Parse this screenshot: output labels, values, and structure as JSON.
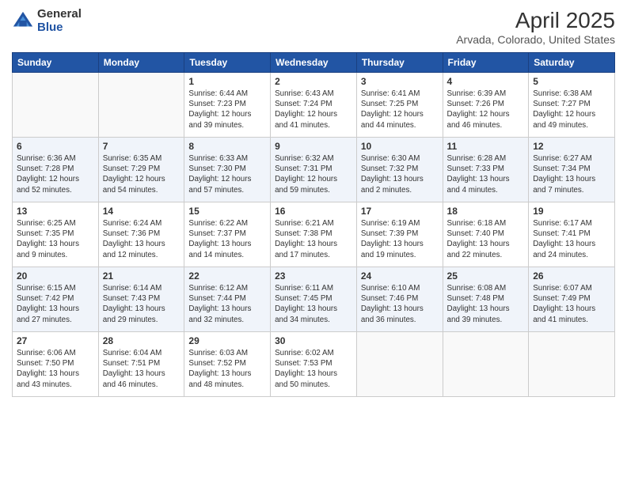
{
  "logo": {
    "general": "General",
    "blue": "Blue"
  },
  "title": "April 2025",
  "subtitle": "Arvada, Colorado, United States",
  "days_of_week": [
    "Sunday",
    "Monday",
    "Tuesday",
    "Wednesday",
    "Thursday",
    "Friday",
    "Saturday"
  ],
  "weeks": [
    [
      {
        "day": "",
        "info": ""
      },
      {
        "day": "",
        "info": ""
      },
      {
        "day": "1",
        "info": "Sunrise: 6:44 AM\nSunset: 7:23 PM\nDaylight: 12 hours and 39 minutes."
      },
      {
        "day": "2",
        "info": "Sunrise: 6:43 AM\nSunset: 7:24 PM\nDaylight: 12 hours and 41 minutes."
      },
      {
        "day": "3",
        "info": "Sunrise: 6:41 AM\nSunset: 7:25 PM\nDaylight: 12 hours and 44 minutes."
      },
      {
        "day": "4",
        "info": "Sunrise: 6:39 AM\nSunset: 7:26 PM\nDaylight: 12 hours and 46 minutes."
      },
      {
        "day": "5",
        "info": "Sunrise: 6:38 AM\nSunset: 7:27 PM\nDaylight: 12 hours and 49 minutes."
      }
    ],
    [
      {
        "day": "6",
        "info": "Sunrise: 6:36 AM\nSunset: 7:28 PM\nDaylight: 12 hours and 52 minutes."
      },
      {
        "day": "7",
        "info": "Sunrise: 6:35 AM\nSunset: 7:29 PM\nDaylight: 12 hours and 54 minutes."
      },
      {
        "day": "8",
        "info": "Sunrise: 6:33 AM\nSunset: 7:30 PM\nDaylight: 12 hours and 57 minutes."
      },
      {
        "day": "9",
        "info": "Sunrise: 6:32 AM\nSunset: 7:31 PM\nDaylight: 12 hours and 59 minutes."
      },
      {
        "day": "10",
        "info": "Sunrise: 6:30 AM\nSunset: 7:32 PM\nDaylight: 13 hours and 2 minutes."
      },
      {
        "day": "11",
        "info": "Sunrise: 6:28 AM\nSunset: 7:33 PM\nDaylight: 13 hours and 4 minutes."
      },
      {
        "day": "12",
        "info": "Sunrise: 6:27 AM\nSunset: 7:34 PM\nDaylight: 13 hours and 7 minutes."
      }
    ],
    [
      {
        "day": "13",
        "info": "Sunrise: 6:25 AM\nSunset: 7:35 PM\nDaylight: 13 hours and 9 minutes."
      },
      {
        "day": "14",
        "info": "Sunrise: 6:24 AM\nSunset: 7:36 PM\nDaylight: 13 hours and 12 minutes."
      },
      {
        "day": "15",
        "info": "Sunrise: 6:22 AM\nSunset: 7:37 PM\nDaylight: 13 hours and 14 minutes."
      },
      {
        "day": "16",
        "info": "Sunrise: 6:21 AM\nSunset: 7:38 PM\nDaylight: 13 hours and 17 minutes."
      },
      {
        "day": "17",
        "info": "Sunrise: 6:19 AM\nSunset: 7:39 PM\nDaylight: 13 hours and 19 minutes."
      },
      {
        "day": "18",
        "info": "Sunrise: 6:18 AM\nSunset: 7:40 PM\nDaylight: 13 hours and 22 minutes."
      },
      {
        "day": "19",
        "info": "Sunrise: 6:17 AM\nSunset: 7:41 PM\nDaylight: 13 hours and 24 minutes."
      }
    ],
    [
      {
        "day": "20",
        "info": "Sunrise: 6:15 AM\nSunset: 7:42 PM\nDaylight: 13 hours and 27 minutes."
      },
      {
        "day": "21",
        "info": "Sunrise: 6:14 AM\nSunset: 7:43 PM\nDaylight: 13 hours and 29 minutes."
      },
      {
        "day": "22",
        "info": "Sunrise: 6:12 AM\nSunset: 7:44 PM\nDaylight: 13 hours and 32 minutes."
      },
      {
        "day": "23",
        "info": "Sunrise: 6:11 AM\nSunset: 7:45 PM\nDaylight: 13 hours and 34 minutes."
      },
      {
        "day": "24",
        "info": "Sunrise: 6:10 AM\nSunset: 7:46 PM\nDaylight: 13 hours and 36 minutes."
      },
      {
        "day": "25",
        "info": "Sunrise: 6:08 AM\nSunset: 7:48 PM\nDaylight: 13 hours and 39 minutes."
      },
      {
        "day": "26",
        "info": "Sunrise: 6:07 AM\nSunset: 7:49 PM\nDaylight: 13 hours and 41 minutes."
      }
    ],
    [
      {
        "day": "27",
        "info": "Sunrise: 6:06 AM\nSunset: 7:50 PM\nDaylight: 13 hours and 43 minutes."
      },
      {
        "day": "28",
        "info": "Sunrise: 6:04 AM\nSunset: 7:51 PM\nDaylight: 13 hours and 46 minutes."
      },
      {
        "day": "29",
        "info": "Sunrise: 6:03 AM\nSunset: 7:52 PM\nDaylight: 13 hours and 48 minutes."
      },
      {
        "day": "30",
        "info": "Sunrise: 6:02 AM\nSunset: 7:53 PM\nDaylight: 13 hours and 50 minutes."
      },
      {
        "day": "",
        "info": ""
      },
      {
        "day": "",
        "info": ""
      },
      {
        "day": "",
        "info": ""
      }
    ]
  ]
}
